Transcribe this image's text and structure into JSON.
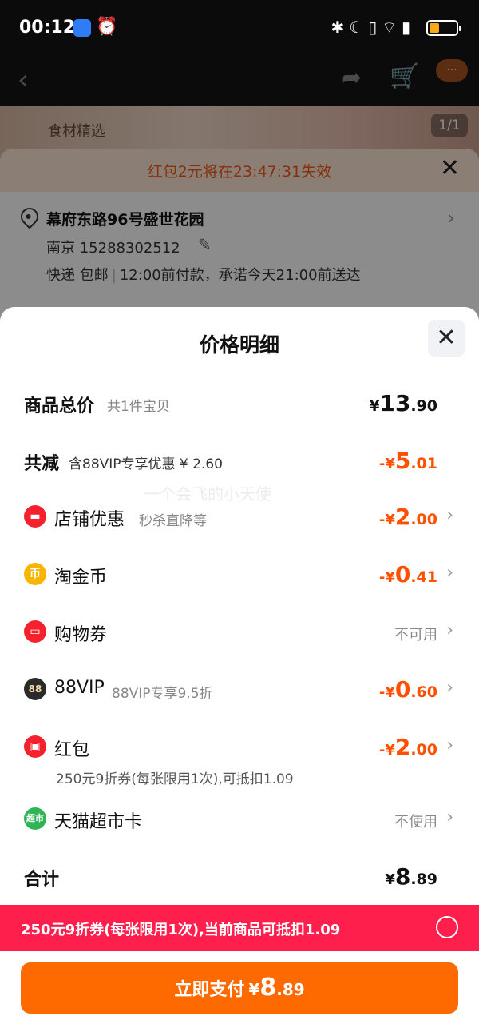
{
  "status_bar": {
    "time": "00:12",
    "right_icons": "✱☾▯⌔▮"
  },
  "background": {
    "image_counter": "1/1",
    "image_caption": "食材精选",
    "banner": "红包2元将在23:47:31失效",
    "address": {
      "title": "幕府东路96号盛世花园",
      "contact": "南京  15288302512",
      "delivery_method": "快递 包邮",
      "delivery_promise": "12:00前付款，承诺今天21:00前送达"
    },
    "header_badge": "···"
  },
  "sheet": {
    "title": "价格明细",
    "rows": [
      {
        "label": "商品总价",
        "sub": "共1件宝贝",
        "currency": "¥",
        "int": "13",
        "dec": ".90"
      },
      {
        "label": "共减",
        "sub": "含88VIP专享优惠 ¥ 2.60",
        "currency": "-¥",
        "int": "5",
        "dec": ".01"
      },
      {
        "label": "店铺优惠",
        "sub": "秒杀直降等",
        "currency": "-¥",
        "int": "2",
        "dec": ".00",
        "icon": "store-icon"
      },
      {
        "label": "淘金币",
        "sub": "",
        "currency": "-¥",
        "int": "0",
        "dec": ".41",
        "icon": "coin-icon"
      },
      {
        "label": "购物券",
        "sub": "",
        "status": "不可用",
        "icon": "voucher-icon"
      },
      {
        "label": "88VIP",
        "sub": "88VIP专享9.5折",
        "currency": "-¥",
        "int": "0",
        "dec": ".60",
        "icon": "vip-88-icon"
      },
      {
        "label": "红包",
        "sub": "",
        "currency": "-¥",
        "int": "2",
        "dec": ".00",
        "note": "250元9折券(每张限用1次),可抵扣1.09",
        "icon": "red-packet-icon"
      },
      {
        "label": "天猫超市卡",
        "sub": "",
        "status": "不使用",
        "icon": "tmall-supermarket-card-icon"
      }
    ],
    "total": {
      "label": "合计",
      "currency": "¥",
      "int": "8",
      "dec": ".89"
    },
    "coupon_bar": "250元9折券(每张限用1次),当前商品可抵扣1.09",
    "pay": {
      "label": "立即支付",
      "currency": "¥",
      "int": "8",
      "dec": ".89"
    },
    "watermark": "一个会飞的小天使"
  },
  "colors": {
    "accent_orange": "#ff5000",
    "pay_button": "#ff6a00",
    "coupon_bar": "#ff1f4d"
  }
}
